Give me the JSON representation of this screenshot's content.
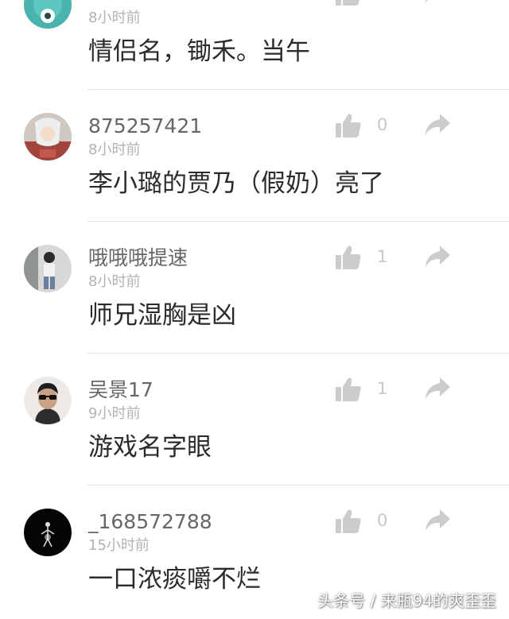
{
  "comments": [
    {
      "username": "",
      "time": "8小时前",
      "content": "情侣名，锄禾。当午",
      "like_count": "",
      "avatar": "teal-cartoon-avatar"
    },
    {
      "username": "875257421",
      "time": "8小时前",
      "content": "李小璐的贾乃（假奶）亮了",
      "like_count": "0",
      "avatar": "anime-character-avatar"
    },
    {
      "username": "哦哦哦提速",
      "time": "8小时前",
      "content": "师兄湿胸是凶",
      "like_count": "1",
      "avatar": "person-photo-avatar"
    },
    {
      "username": "吴景17",
      "time": "9小时前",
      "content": "游戏名字眼",
      "like_count": "1",
      "avatar": "man-sunglasses-avatar"
    },
    {
      "username": "_168572788",
      "time": "15小时前",
      "content": "一口浓痰嚼不烂",
      "like_count": "0",
      "avatar": "dark-figure-avatar"
    }
  ],
  "watermark": "头条号 / 来瓶94的爽歪歪",
  "colors": {
    "username": "#666666",
    "time": "#b3b3b3",
    "content": "#2b2b2b",
    "icon": "#cccccc",
    "divider": "#e3e3e3"
  }
}
